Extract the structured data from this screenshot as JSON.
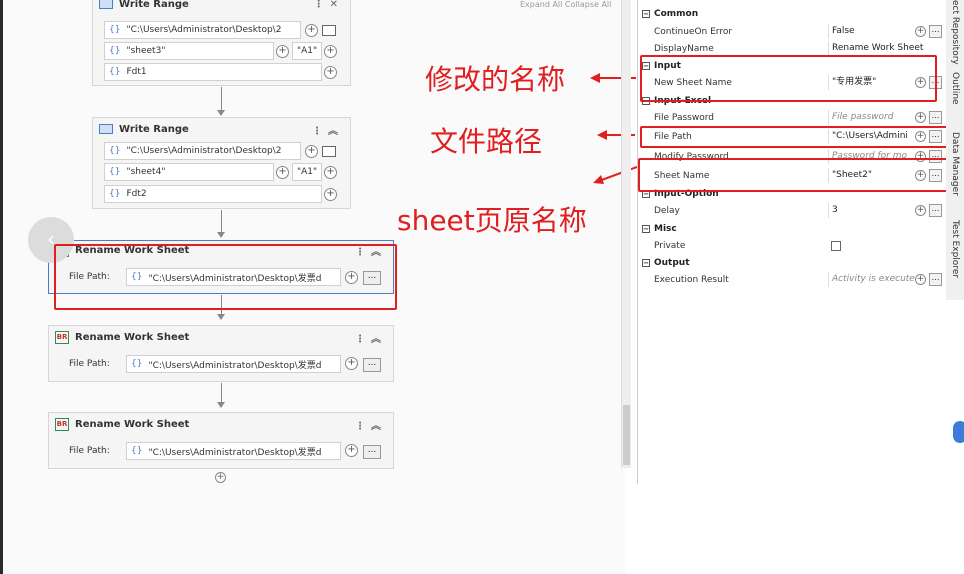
{
  "workflow": {
    "top_strip": "Expand All  Collapse All",
    "write1": {
      "title": "Write Range",
      "path": "\"C:\\Users\\Administrator\\Desktop\\2",
      "sheet": "\"sheet3\"",
      "cell": "\"A1\"",
      "data": "Fdt1"
    },
    "write2": {
      "title": "Write Range",
      "path": "\"C:\\Users\\Administrator\\Desktop\\2",
      "sheet": "\"sheet4\"",
      "cell": "\"A1\"",
      "data": "Fdt2"
    },
    "rename1": {
      "title": "Rename Work Sheet",
      "file_label": "File Path:",
      "path": "\"C:\\Users\\Administrator\\Desktop\\发票d"
    },
    "rename2": {
      "title": "Rename Work Sheet",
      "file_label": "File Path:",
      "path": "\"C:\\Users\\Administrator\\Desktop\\发票d"
    },
    "rename3": {
      "title": "Rename Work Sheet",
      "file_label": "File Path:",
      "path": "\"C:\\Users\\Administrator\\Desktop\\发票d"
    },
    "brace": "{}",
    "ellipsis": "...",
    "plus": "+",
    "back_arrow": "‹"
  },
  "annotations": {
    "new_name": "修改的名称",
    "file_path": "文件路径",
    "sheet_orig": "sheet页原名称"
  },
  "properties": {
    "common": "Common",
    "continue_label": "ContinueOn Error",
    "continue_val": "False",
    "display_label": "DisplayName",
    "display_val": "Rename Work Sheet",
    "input": "Input",
    "new_sheet_label": "New Sheet Name",
    "new_sheet_val": "\"专用发票\"",
    "input_excel": "Input-Excel",
    "file_password_label": "File Password",
    "file_password_ph": "File password",
    "file_path_label": "File Path",
    "file_path_val": "\"C:\\Users\\Admini",
    "modify_password_label": "Modify Password",
    "modify_password_ph": "Password for mo",
    "sheet_name_label": "Sheet Name",
    "sheet_name_val": "\"Sheet2\"",
    "input_option": "Input-Option",
    "delay_label": "Delay",
    "delay_val": "3",
    "misc": "Misc",
    "private_label": "Private",
    "output": "Output",
    "exec_label": "Execution Result",
    "exec_ph": "Activity is execute",
    "collapse": "−"
  },
  "right_tabs": {
    "repo": "ect Repository",
    "outline": "Outline",
    "data_manager": "Data Manager",
    "test_explorer": "Test Explorer"
  },
  "colors": {
    "annotation_red": "#e02020",
    "accent_blue": "#4a7fc1"
  }
}
